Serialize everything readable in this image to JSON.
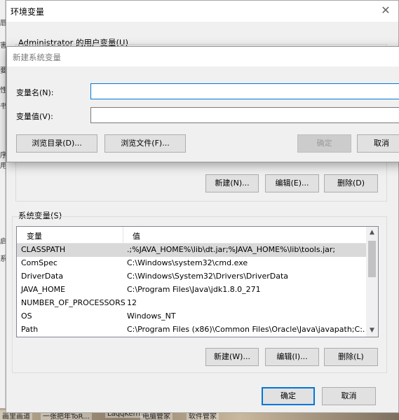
{
  "env_dialog": {
    "title": "环境变量",
    "close_icon": "✕",
    "user_section_label": "Administrator 的用户变量(U)",
    "user_buttons": {
      "new": "新建(N)...",
      "edit": "编辑(E)...",
      "delete": "删除(D)"
    },
    "system_section_label": "系统变量(S)",
    "system_list": {
      "columns": [
        "变量",
        "值"
      ],
      "rows": [
        {
          "name": "CLASSPATH",
          "value": ".;%JAVA_HOME%\\lib\\dt.jar;%JAVA_HOME%\\lib\\tools.jar;",
          "selected": true
        },
        {
          "name": "ComSpec",
          "value": "C:\\Windows\\system32\\cmd.exe",
          "selected": false
        },
        {
          "name": "DriverData",
          "value": "C:\\Windows\\System32\\Drivers\\DriverData",
          "selected": false
        },
        {
          "name": "JAVA_HOME",
          "value": "C:\\Program Files\\Java\\jdk1.8.0_271",
          "selected": false
        },
        {
          "name": "NUMBER_OF_PROCESSORS",
          "value": "12",
          "selected": false
        },
        {
          "name": "OS",
          "value": "Windows_NT",
          "selected": false
        },
        {
          "name": "Path",
          "value": "C:\\Program Files (x86)\\Common Files\\Oracle\\Java\\javapath;C:...",
          "selected": false
        }
      ],
      "scroll_up_icon": "▲",
      "scroll_down_icon": "▼"
    },
    "system_buttons": {
      "new": "新建(W)...",
      "edit": "编辑(I)...",
      "delete": "删除(L)"
    },
    "footer_buttons": {
      "ok": "确定",
      "cancel": "取消"
    }
  },
  "new_var_dialog": {
    "title": "新建系统变量",
    "name_label": "变量名(N):",
    "name_value": "",
    "value_label": "变量值(V):",
    "value_value": "",
    "buttons": {
      "browse_dir": "浏览目录(D)...",
      "browse_file": "浏览文件(F)...",
      "ok": "确定",
      "cancel": "取消"
    }
  },
  "behind_window_chars": [
    "唇",
    "害",
    "要",
    "性",
    "书",
    "序",
    "用",
    "启",
    "系"
  ],
  "taskbar": [
    "画里画道",
    "一张把年ToR...",
    "LaqqKerrn...",
    "电脑管家",
    "软件管家"
  ]
}
